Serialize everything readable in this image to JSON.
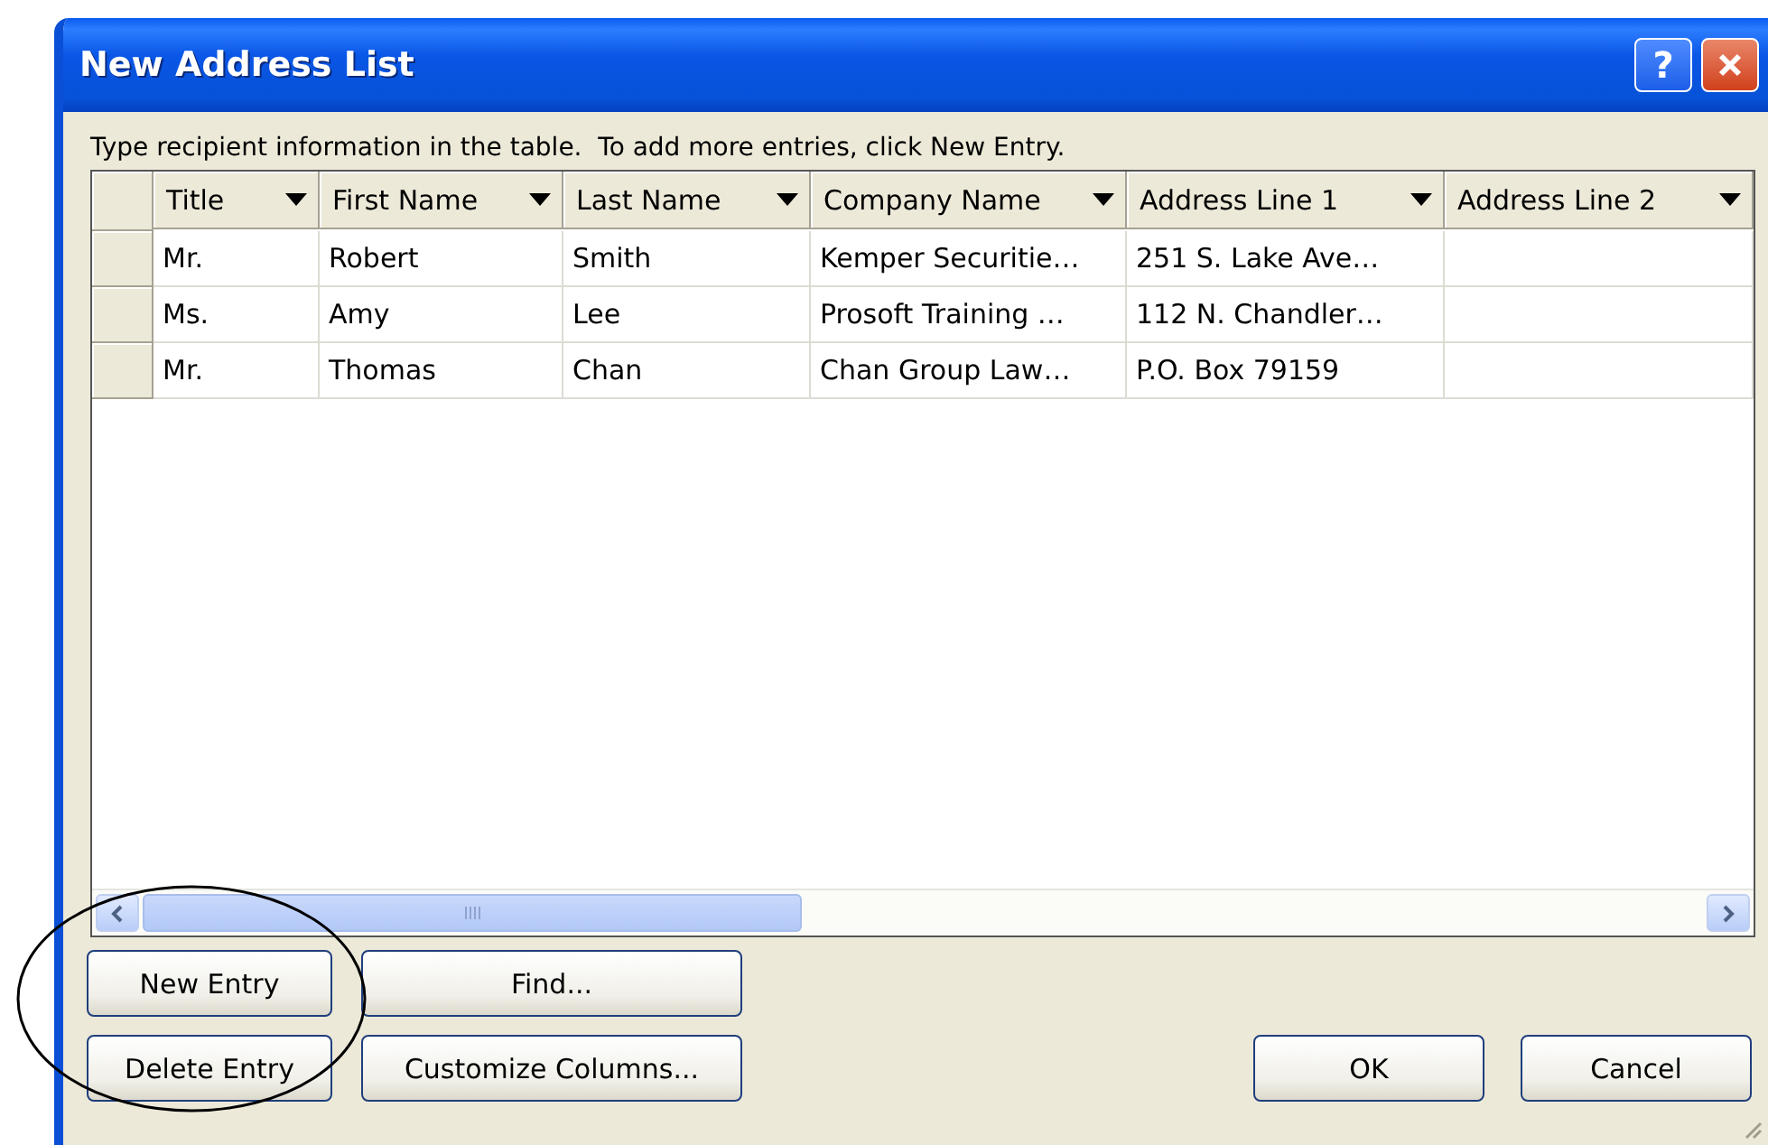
{
  "window": {
    "title": "New Address List",
    "title_buttons": [
      {
        "kind": "help",
        "label": "?"
      },
      {
        "kind": "close"
      }
    ]
  },
  "instruction": "Type recipient information in the table.  To add more entries, click New Entry.",
  "table": {
    "columns": [
      "Title",
      "First Name",
      "Last Name",
      "Company Name",
      "Address Line 1",
      "Address Line 2"
    ],
    "rows": [
      [
        "Mr.",
        "Robert",
        "Smith",
        "Kemper Securitie…",
        "251 S. Lake Ave…"
      ],
      [
        "Ms.",
        "Amy",
        "Lee",
        "Prosoft Training …",
        "112 N. Chandler…"
      ],
      [
        "Mr.",
        "Thomas",
        "Chan",
        "Chan Group Law…",
        "P.O. Box 79159"
      ]
    ]
  },
  "left_buttons": [
    "New Entry",
    "Find...",
    "Delete Entry",
    "Customize Columns..."
  ],
  "right_buttons": [
    "OK",
    "Cancel"
  ]
}
